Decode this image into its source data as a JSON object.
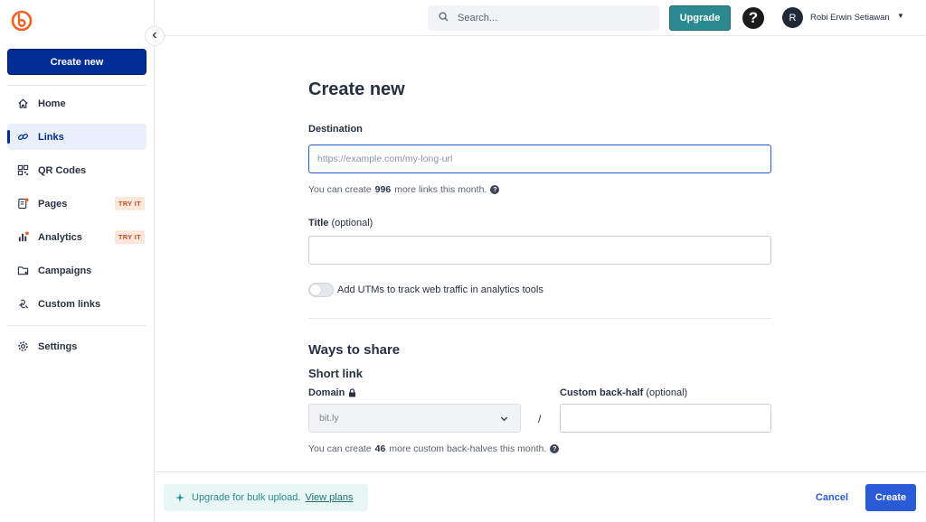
{
  "sidebar": {
    "create_label": "Create new",
    "items": [
      {
        "label": "Home",
        "icon": "home-icon"
      },
      {
        "label": "Links",
        "icon": "link-icon",
        "active": true
      },
      {
        "label": "QR Codes",
        "icon": "qr-code-icon"
      },
      {
        "label": "Pages",
        "icon": "pages-icon",
        "badge": "TRY IT"
      },
      {
        "label": "Analytics",
        "icon": "analytics-icon",
        "badge": "TRY IT"
      },
      {
        "label": "Campaigns",
        "icon": "campaigns-icon"
      },
      {
        "label": "Custom links",
        "icon": "custom-links-icon"
      },
      {
        "label": "Settings",
        "icon": "settings-icon"
      }
    ]
  },
  "topbar": {
    "search_placeholder": "Search...",
    "upgrade_label": "Upgrade",
    "help_label": "?",
    "avatar_initial": "R",
    "user_name": "Robi Erwin Setiawan"
  },
  "form": {
    "title": "Create new",
    "destination_label": "Destination",
    "destination_placeholder": "https://example.com/my-long-url",
    "destination_value": "",
    "links_hint_pre": "You can create",
    "links_remaining": "996",
    "links_hint_post": "more links this month.",
    "title_label": "Title",
    "title_optional": "(optional)",
    "title_value": "",
    "utm_label": "Add UTMs to track web traffic in analytics tools",
    "utm_enabled": false,
    "share_heading": "Ways to share",
    "short_link_heading": "Short link",
    "domain_label": "Domain",
    "domain_value": "bit.ly",
    "slash": "/",
    "backhalf_label": "Custom back-half",
    "backhalf_optional": "(optional)",
    "backhalf_value": "",
    "backhalf_hint_pre": "You can create",
    "backhalf_remaining": "46",
    "backhalf_hint_post": "more custom back-halves this month."
  },
  "footer": {
    "promo_text": "Upgrade for bulk upload.",
    "promo_link": "View plans",
    "cancel_label": "Cancel",
    "create_label": "Create"
  },
  "colors": {
    "brand_orange": "#ee6123",
    "primary_navy": "#022d94",
    "primary_blue": "#2a5bd7",
    "teal": "#2b8a8f"
  }
}
